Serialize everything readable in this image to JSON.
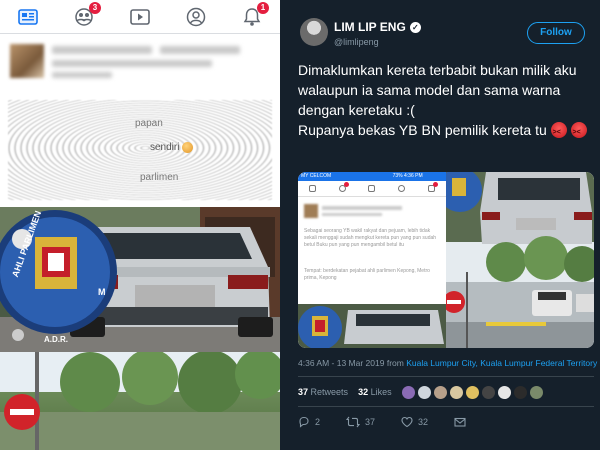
{
  "left": {
    "nav": {
      "friends_badge": "3",
      "notifications_badge": "1"
    },
    "post": {
      "ghost_line1": "papan",
      "ghost_line2": "sendiri",
      "ghost_line3": "parlimen"
    },
    "photo": {
      "emblem_text_left": "AHLI PARLIMEN",
      "emblem_text_right": "M",
      "emblem_bottom": "A.D.R."
    }
  },
  "tweet": {
    "author_name": "LIM LIP ENG",
    "handle": "@limlipeng",
    "follow_label": "Follow",
    "text_line1": "Dimaklumkan kereta terbabit bukan milik aku walaupun ia sama model dan sama warna dengan keretaku :(",
    "text_line2": "Rupanya bekas YB BN pemilik kereta tu",
    "time": "4:36 AM - 13 Mar 2019 from",
    "location": "Kuala Lumpur City, Kuala Lumpur Federal Territory",
    "retweets_count": "37",
    "retweets_label": "Retweets",
    "likes_count": "32",
    "likes_label": "Likes",
    "reply_count": "2",
    "retweet_count": "37",
    "like_count": "32",
    "embedded": {
      "status_carrier": "MY CELCOM",
      "status_info": "73% 4:36 PM",
      "text_a": "Sebagai seorang YB wakil rakyat dan pejuam, lebih tidak sekali menggaji sudah mengkut kereta pun yang pun sudah betul Buku pun yang pun mengambil betul itu",
      "text_b": "Tempat: berdekatan pejabat ahli parlimen Kepong, Metro prima, Kepong"
    }
  },
  "colors": {
    "twitter_bg": "#15202b",
    "twitter_blue": "#1da1f2",
    "fb_badge": "#e41e3f"
  }
}
